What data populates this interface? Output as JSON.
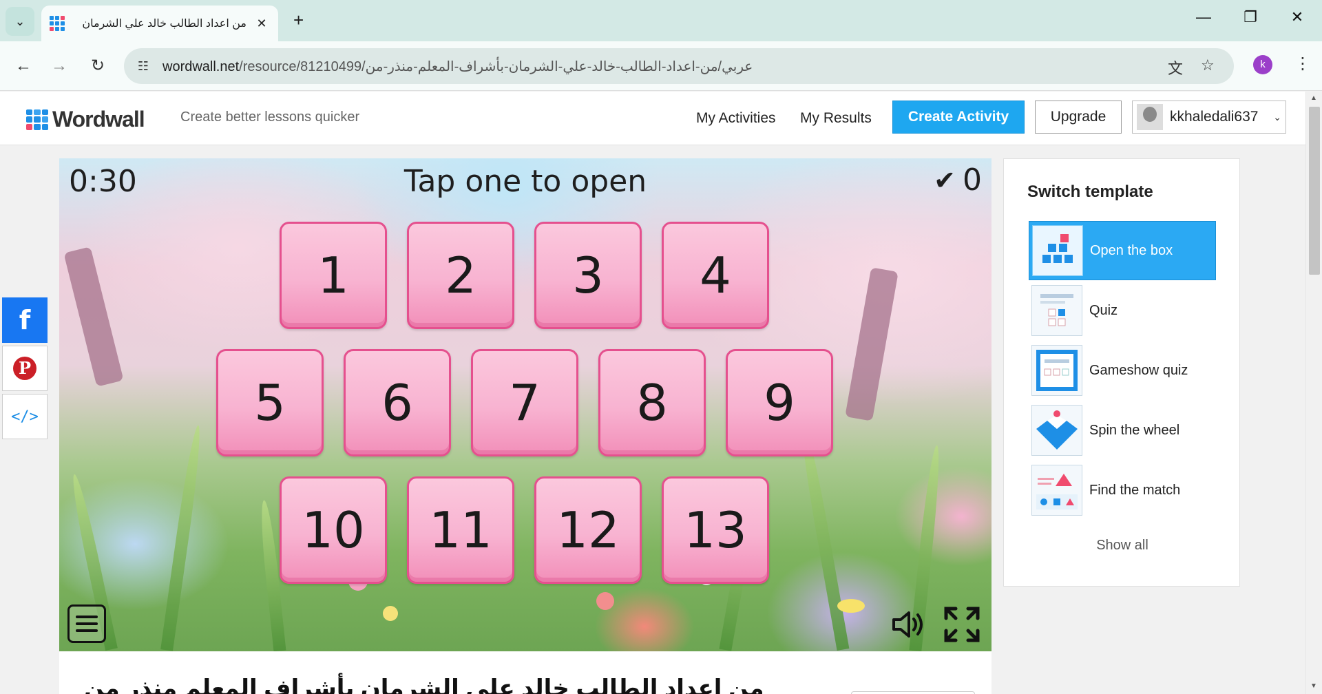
{
  "browser": {
    "tab_title": "من اعداد الطالب خالد علي الشرمان",
    "tab_close": "✕",
    "new_tab": "+",
    "url_domain": "wordwall.net",
    "url_path": "/resource/81210499/عربي/من-اعداد-الطالب-خالد-علي-الشرمان-بأشراف-المعلم-منذر-من",
    "profile_initial": "k",
    "window_controls": {
      "minimize": "—",
      "restore": "❐",
      "close": "✕"
    }
  },
  "site": {
    "logo_text": "Wordwall",
    "tagline": "Create better lessons quicker",
    "nav": {
      "my_activities": "My Activities",
      "my_results": "My Results"
    },
    "create_button": "Create Activity",
    "upgrade_button": "Upgrade",
    "username": "kkhaledali637"
  },
  "game": {
    "timer": "0:30",
    "prompt": "Tap one to open",
    "score": "0",
    "boxes": [
      "1",
      "2",
      "3",
      "4",
      "5",
      "6",
      "7",
      "8",
      "9",
      "10",
      "11",
      "12",
      "13"
    ]
  },
  "activity_title": "من اعداد الطالب خالد علي الشرمان بأشراف المعلم منذر من",
  "switch_template": {
    "heading": "Switch template",
    "items": [
      {
        "label": "Open the box",
        "icon": "open-the-box-icon",
        "active": true
      },
      {
        "label": "Quiz",
        "icon": "quiz-icon",
        "active": false
      },
      {
        "label": "Gameshow quiz",
        "icon": "gameshow-quiz-icon",
        "active": false
      },
      {
        "label": "Spin the wheel",
        "icon": "spin-the-wheel-icon",
        "active": false
      },
      {
        "label": "Find the match",
        "icon": "find-the-match-icon",
        "active": false
      }
    ],
    "show_all": "Show all"
  },
  "colors": {
    "accent": "#1ea7f0",
    "box_pink": "#f8b3d1",
    "box_border": "#e5508e",
    "facebook": "#1877f2",
    "pinterest": "#cb1f27"
  }
}
